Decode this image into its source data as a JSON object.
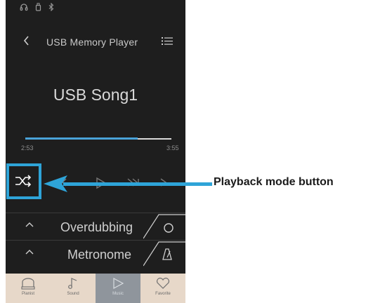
{
  "header": {
    "title": "USB Memory Player"
  },
  "player": {
    "song_title": "USB Song1",
    "elapsed": "2:53",
    "total": "3:55",
    "progress_fraction": 0.77
  },
  "panels": [
    {
      "label": "Overdubbing",
      "icon": "record-circle-icon"
    },
    {
      "label": "Metronome",
      "icon": "metronome-icon"
    }
  ],
  "tabs": [
    {
      "label": "Pianist",
      "icon": "piano-icon"
    },
    {
      "label": "Sound",
      "icon": "music-note-icon"
    },
    {
      "label": "Music",
      "icon": "play-icon",
      "active": true
    },
    {
      "label": "Favorite",
      "icon": "heart-icon"
    }
  ],
  "callout": {
    "label": "Playback mode button"
  },
  "colors": {
    "accent": "#2ea4d8",
    "background": "#1e1e1e",
    "tabbar": "#e7d8c9"
  }
}
